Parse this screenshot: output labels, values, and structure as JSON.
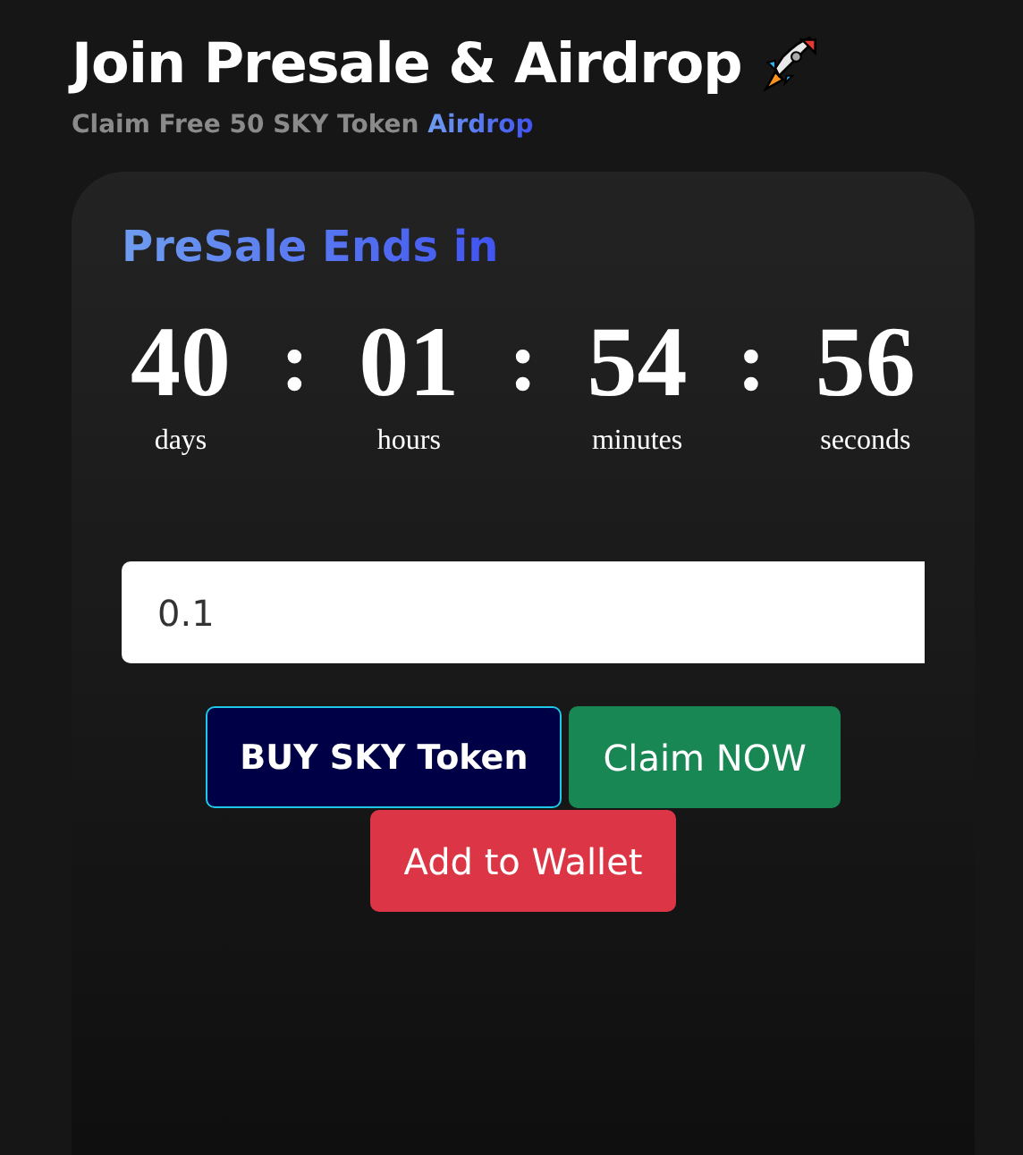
{
  "header": {
    "title": "Join Presale & Airdrop",
    "subtitle": "Claim Free 50 SKY Token",
    "subtitle_link": "Airdrop"
  },
  "card": {
    "heading": "PreSale Ends in",
    "countdown": [
      {
        "value": "40",
        "unit": "days"
      },
      {
        "value": "01",
        "unit": "hours"
      },
      {
        "value": "54",
        "unit": "minutes"
      },
      {
        "value": "56",
        "unit": "seconds"
      }
    ],
    "separator": ":",
    "amount_field": {
      "value": "0.1"
    },
    "buttons": [
      {
        "label": "BUY SKY Token",
        "kind": "buy"
      },
      {
        "label": "Claim NOW",
        "kind": "claim"
      },
      {
        "label": "Add to Wallet",
        "kind": "wallet"
      }
    ]
  }
}
